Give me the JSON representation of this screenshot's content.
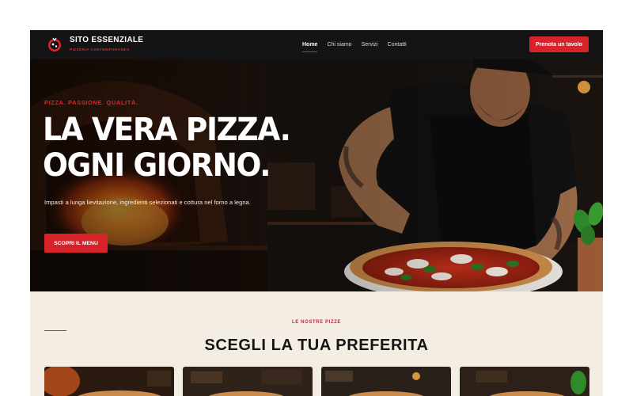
{
  "brand": {
    "name": "SITO ESSENZIALE",
    "tagline": "PIZZERIA CONTEMPORANEA"
  },
  "nav": {
    "links": [
      "Home",
      "Chi siamo",
      "Servizi",
      "Contatti"
    ],
    "active": "Home",
    "cta_label": "Prenota un tavolo"
  },
  "hero": {
    "eyebrow": "PIZZA. PASSIONE. QUALITÀ.",
    "title_line1": "LA VERA PIZZA.",
    "title_line2": "OGNI GIORNO.",
    "text": "Impasti a lunga lievitazione, ingredienti selezionati e cottura nel forno a legna.",
    "button_label": "SCOPRI IL MENU"
  },
  "section": {
    "eyebrow": "LE NOSTRE PIZZE",
    "title": "SCEGLI LA TUA PREFERITA"
  },
  "colors": {
    "accent": "#d8222a",
    "nav_bg": "#141414",
    "section_bg": "#f4ede4"
  }
}
